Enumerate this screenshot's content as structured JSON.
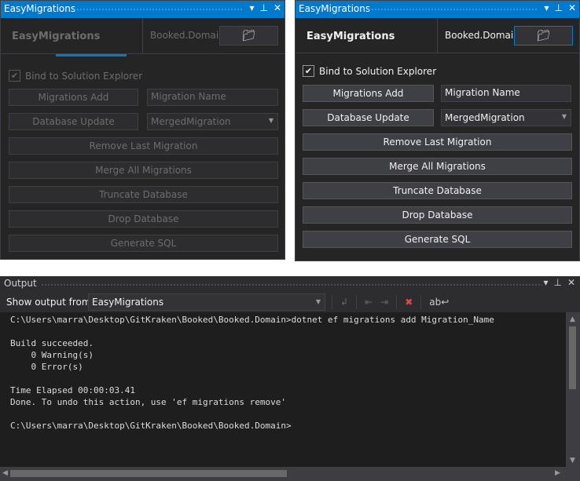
{
  "panels": [
    {
      "state": "disabled",
      "title": "EasyMigrations",
      "header_name": "EasyMigrations",
      "project": "Booked.Domair",
      "bind_label": "Bind to Solution Explorer",
      "bind_checked": true,
      "migrations_add": "Migrations Add",
      "migration_name_value": "Migration Name",
      "database_update": "Database Update",
      "migration_select": "MergedMigration",
      "remove_last": "Remove Last Migration",
      "merge_all": "Merge All Migrations",
      "truncate": "Truncate Database",
      "drop": "Drop Database",
      "generate_sql": "Generate SQL"
    },
    {
      "state": "enabled",
      "title": "EasyMigrations",
      "header_name": "EasyMigrations",
      "project": "Booked.Domair",
      "bind_label": "Bind to Solution Explorer",
      "bind_checked": true,
      "migrations_add": "Migrations Add",
      "migration_name_value": "Migration Name",
      "database_update": "Database Update",
      "migration_select": "MergedMigration",
      "remove_last": "Remove Last Migration",
      "merge_all": "Merge All Migrations",
      "truncate": "Truncate Database",
      "drop": "Drop Database",
      "generate_sql": "Generate SQL"
    }
  ],
  "output": {
    "title": "Output",
    "show_from_label": "Show output from:",
    "source": "EasyMigrations",
    "lines": [
      "C:\\Users\\marra\\Desktop\\GitKraken\\Booked\\Booked.Domain>dotnet ef migrations add Migration_Name",
      "",
      "Build succeeded.",
      "    0 Warning(s)",
      "    0 Error(s)",
      "",
      "Time Elapsed 00:00:03.41",
      "Done. To undo this action, use 'ef migrations remove'",
      "",
      "C:\\Users\\marra\\Desktop\\GitKraken\\Booked\\Booked.Domain>"
    ]
  },
  "colors": {
    "accent": "#007acc",
    "panel_bg": "#252526",
    "console_bg": "#1e1e1e"
  }
}
